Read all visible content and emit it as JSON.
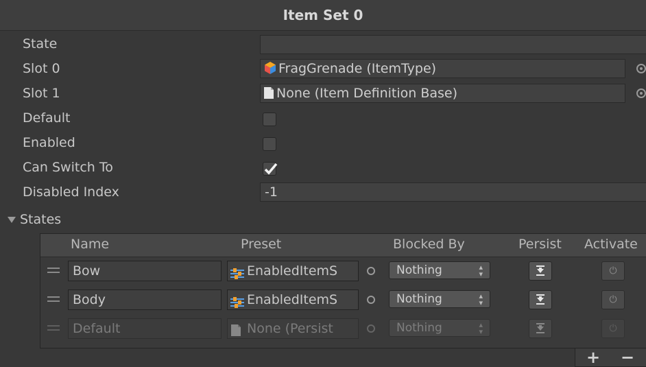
{
  "header": {
    "title": "Item Set 0"
  },
  "fields": {
    "state": {
      "label": "State",
      "value": ""
    },
    "slot0": {
      "label": "Slot 0",
      "value": "FragGrenade (ItemType)",
      "icon": "item-type-cube-icon"
    },
    "slot1": {
      "label": "Slot 1",
      "value": "None (Item Definition Base)",
      "icon": "document-icon"
    },
    "default": {
      "label": "Default",
      "checked": false
    },
    "enabled": {
      "label": "Enabled",
      "checked": false
    },
    "can_switch_to": {
      "label": "Can Switch To",
      "checked": true
    },
    "disabled_index": {
      "label": "Disabled Index",
      "value": "-1"
    }
  },
  "states": {
    "label": "States",
    "columns": [
      "Name",
      "Preset",
      "Blocked By",
      "Persist",
      "Activate"
    ],
    "rows": [
      {
        "name": "Bow",
        "preset": "EnabledItemS",
        "blocked_by": "Nothing",
        "dimmed": false
      },
      {
        "name": "Body",
        "preset": "EnabledItemS",
        "blocked_by": "Nothing",
        "dimmed": false
      },
      {
        "name": "Default",
        "preset": "None (Persist",
        "blocked_by": "Nothing",
        "dimmed": true
      }
    ],
    "add_label": "+",
    "remove_label": "−"
  },
  "colors": {
    "background": "#383838",
    "field": "#414141",
    "text": "#c8c8c8"
  }
}
